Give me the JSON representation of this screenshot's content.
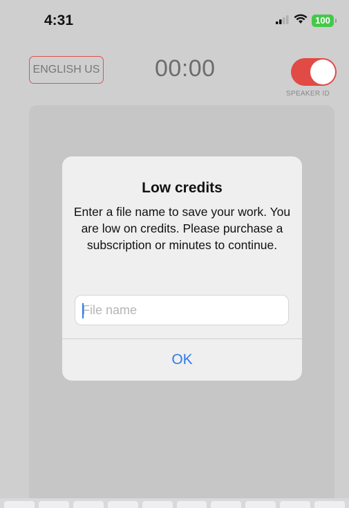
{
  "status_bar": {
    "time": "4:31",
    "battery": "100",
    "icons": [
      "signal-icon",
      "wifi-icon",
      "battery-icon"
    ]
  },
  "header": {
    "language_label": "ENGLISH US",
    "timer": "00:00",
    "speaker_id_label": "SPEAKER ID",
    "speaker_id_enabled": true
  },
  "dialog": {
    "title": "Low credits",
    "message": "Enter a file name to save your work. You are low on credits. Please purchase a subscription or minutes to continue.",
    "input_value": "",
    "input_placeholder": "File name",
    "ok_label": "OK"
  },
  "colors": {
    "accent_blue": "#2f7bea",
    "toggle_red": "#e24a46",
    "battery_green": "#45c84a",
    "lang_border_red": "#d9534f"
  }
}
